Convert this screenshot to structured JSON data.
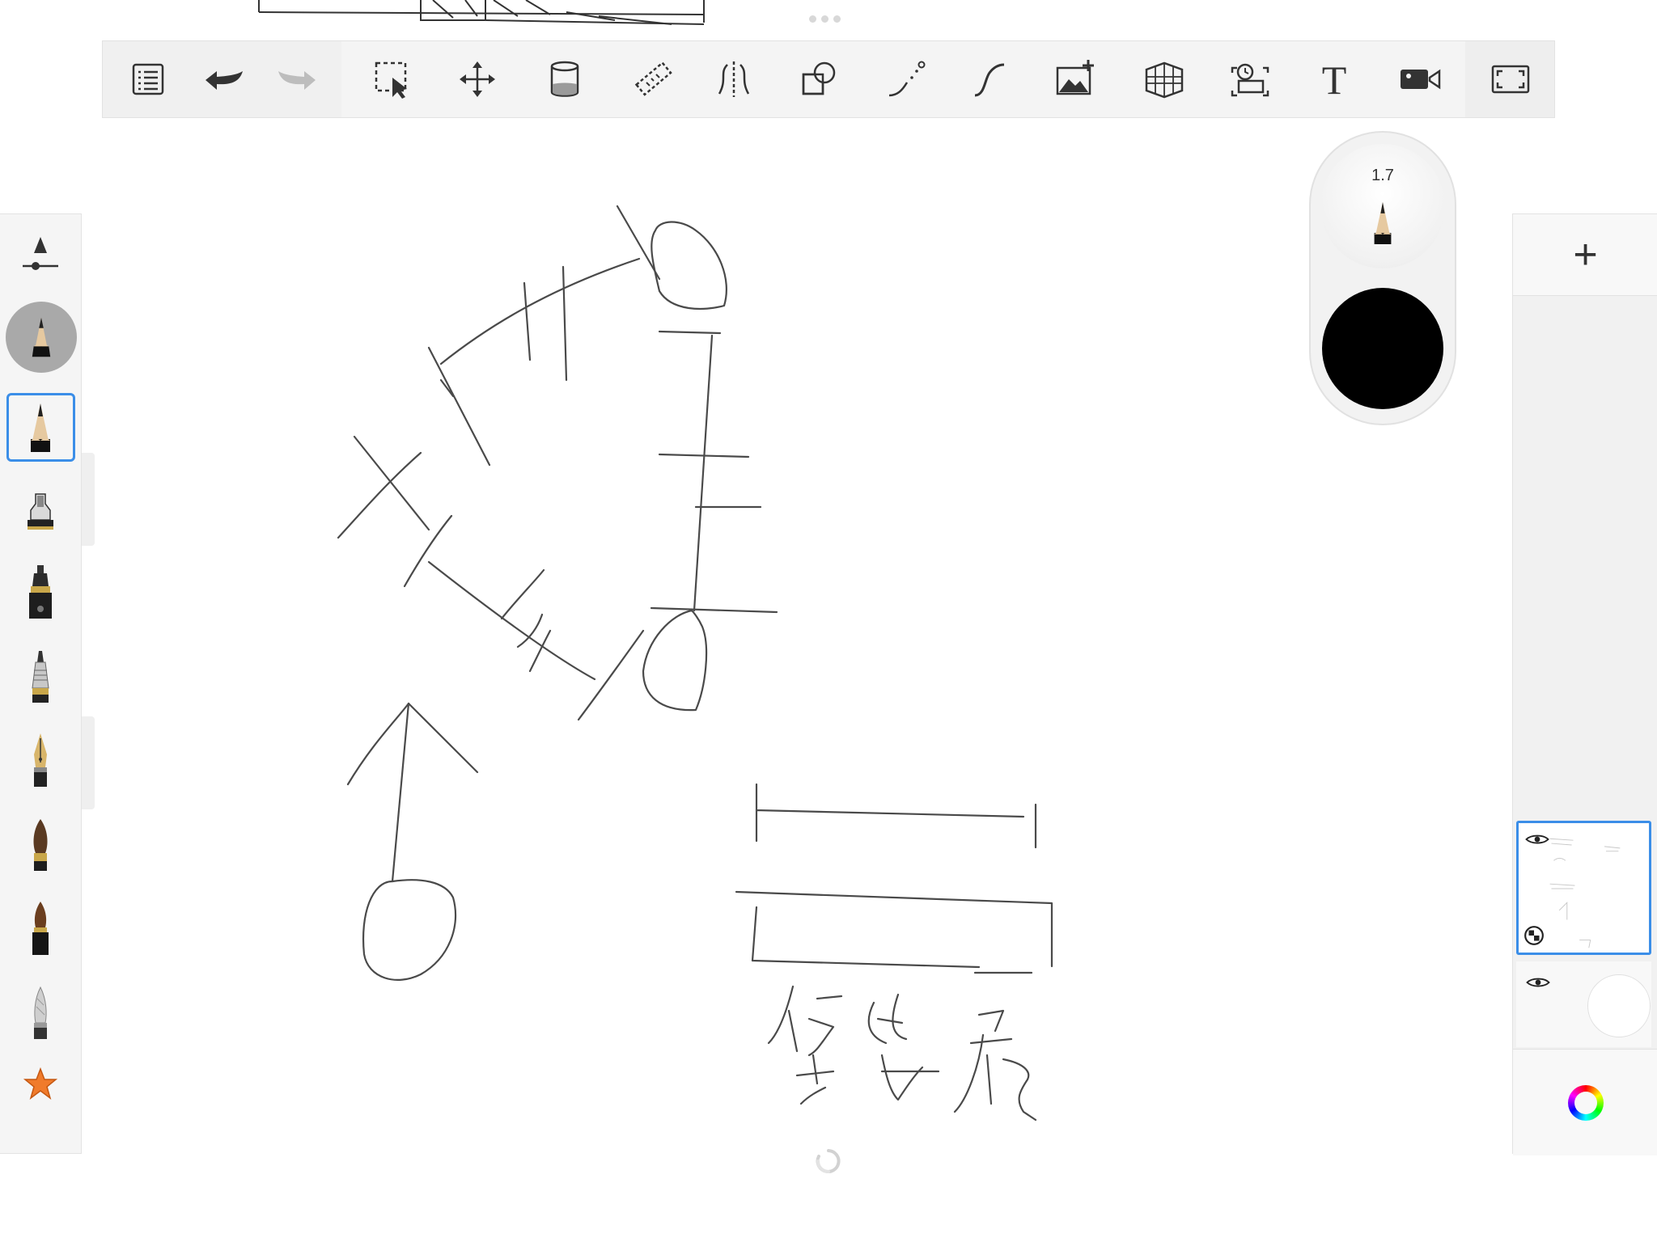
{
  "toolbar": {
    "items": [
      {
        "name": "layers-list-icon"
      },
      {
        "name": "undo-icon"
      },
      {
        "name": "redo-icon"
      },
      {
        "name": "selection-icon"
      },
      {
        "name": "transform-icon"
      },
      {
        "name": "fill-icon"
      },
      {
        "name": "ruler-icon"
      },
      {
        "name": "symmetry-icon"
      },
      {
        "name": "shapes-icon"
      },
      {
        "name": "predictive-stroke-icon"
      },
      {
        "name": "steady-stroke-icon"
      },
      {
        "name": "image-import-icon"
      },
      {
        "name": "perspective-guide-icon"
      },
      {
        "name": "time-lapse-icon"
      },
      {
        "name": "text-icon"
      },
      {
        "name": "video-record-icon"
      },
      {
        "name": "fullscreen-icon"
      }
    ],
    "text_tool_glyph": "T"
  },
  "brush_puck": {
    "size": "1.7",
    "color": "#000000"
  },
  "brushes": {
    "selected": "pencil",
    "items": [
      "pencil",
      "airbrush",
      "marker",
      "ballpoint",
      "fountain-pen",
      "paintbrush",
      "chisel-brush",
      "smudge",
      "favorites-star"
    ]
  },
  "layers": {
    "add_label": "+",
    "accent": "#3b8ee8"
  }
}
